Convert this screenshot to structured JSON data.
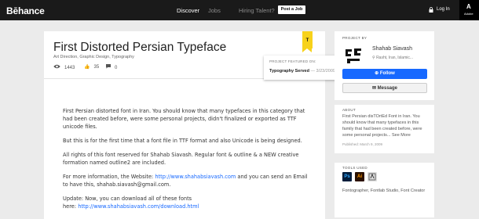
{
  "topbar": {
    "logo": "Bēhance",
    "nav": {
      "discover": "Discover",
      "jobs": "Jobs",
      "hiring": "Hiring Talent?",
      "post_job": "Post a Job"
    },
    "login": "Log In",
    "adobe": "Adobe",
    "adobe_mark": "A"
  },
  "project": {
    "title": "First Distorted Persian Typeface",
    "fields": "Art Direction, Graphic Design, Typography",
    "views": "1443",
    "appreciations": "35",
    "comments": "0",
    "ribbon_letter": "T"
  },
  "featured": {
    "heading": "PROJECT FEATURED ON:",
    "site": "Typography Served",
    "date": "— 3/23/2009"
  },
  "description": {
    "p1": "First Persian distorted font in Iran. You should know that many typefaces in this category that had been created before, were some personal projects, didn't finalized or exported as TTF unicode files.",
    "p2": "But this is for the first time that a font file in TTF format and also Unicode is being designed.",
    "p3": "All rights of this font reserved for Shahab Siavash. Regular font & outline & a NEW creative formation named outline2 are included.",
    "p4_pre": "For more information, the Website: ",
    "p4_link": "http://www.shahabsiavash.com",
    "p4_post": " and you can send an Email to have this, shahab.siavash@gmail.com.",
    "p5": "Update: Now, you can download all of these fonts",
    "p6_pre": "here: ",
    "p6_link": "http://www.shahabsiavash.com/download.html"
  },
  "sidebar": {
    "project_by_label": "PROJECT BY",
    "author": "Shahab Siavash",
    "location": "Rasht, Iran, Islamic...",
    "follow": "Follow",
    "message": "Message",
    "about_label": "ABOUT",
    "about_text": "First Persian disTOrtEd Font in Iran. You should know that many typefaces in this family that had been created before, were some personal projects... See More",
    "published": "Published: March 9, 2009",
    "tools_label": "TOOLS USED",
    "tools": [
      {
        "name": "Ps",
        "color": "#001c3a",
        "fg": "#31a8ff"
      },
      {
        "name": "Ai",
        "color": "#2b1100",
        "fg": "#ff9a00"
      },
      {
        "name": "",
        "color": "#e0e0e0",
        "fg": "#333"
      }
    ],
    "tools_text": "Fontographer, Fontlab Studio, Font Creator"
  },
  "colors": {
    "accent": "#1769ff",
    "ribbon": "#f7d21b",
    "topbar": "#1a1a1a"
  }
}
